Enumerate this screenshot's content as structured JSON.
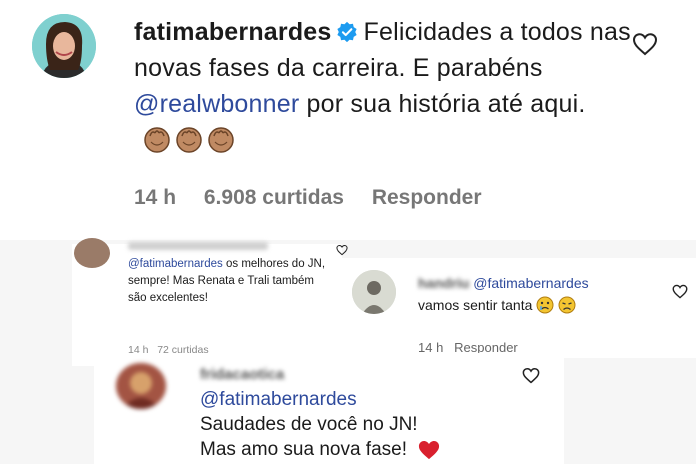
{
  "main_comment": {
    "username": "fatimabernardes",
    "text_before": "Felicidades a todos nas novas fases da carreira. E parabéns ",
    "mention": "@realwbonner",
    "text_after": " por sua história até aqui.",
    "time": "14 h",
    "likes": "6.908 curtidas",
    "reply": "Responder",
    "emoji": "clapping-hands-icon",
    "accent_color": "#2e4a9c",
    "verified_color": "#1d9bf0"
  },
  "comment2": {
    "mention": "@fatimabernardes",
    "text": " os melhores do JN, sempre! Mas Renata e Trali também são excelentes!",
    "time": "14 h",
    "likes": "72 curtidas"
  },
  "comment3": {
    "username": "handriu",
    "mention": "@fatimabernardes",
    "text": "vamos sentir tanta",
    "time": "14 h",
    "reply": "Responder"
  },
  "comment4": {
    "username": "fridacaotica",
    "mention": "@fatimabernardes",
    "line1": "Saudades de você no JN!",
    "line2": "Mas amo sua nova fase!",
    "heart_color": "#d9202e"
  }
}
